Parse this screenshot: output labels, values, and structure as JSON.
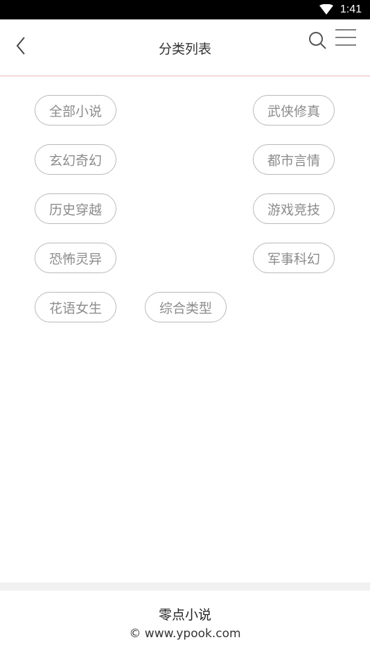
{
  "status_bar": {
    "time": "1:41",
    "icons": [
      "wifi-icon"
    ]
  },
  "header": {
    "title": "分类列表",
    "icons": [
      "back-chevron-icon",
      "search-icon",
      "menu-icon"
    ]
  },
  "categories": [
    "全部小说",
    "武侠修真",
    "玄幻奇幻",
    "都市言情",
    "历史穿越",
    "游戏竞技",
    "恐怖灵异",
    "军事科幻",
    "花语女生",
    "综合类型"
  ],
  "footer": {
    "app_name": "零点小说",
    "copyright": "© www.ypook.com"
  },
  "colors": {
    "header_divider": "#e8b7bb",
    "tag_border": "#b9b9b9",
    "tag_text": "#8c8c8c"
  }
}
